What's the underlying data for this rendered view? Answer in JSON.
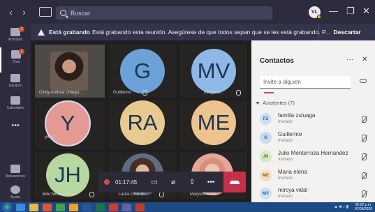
{
  "titlebar": {
    "search_placeholder": "Buscar",
    "user_initials": "VL"
  },
  "rail": {
    "items": [
      {
        "label": "Actividad",
        "badge": "1"
      },
      {
        "label": "Chat",
        "badge": "2"
      },
      {
        "label": "Equipos",
        "badge": ""
      },
      {
        "label": "Calendario",
        "badge": ""
      },
      {
        "label": "Aplicaciones",
        "badge": ""
      },
      {
        "label": "Ayuda",
        "badge": ""
      }
    ],
    "more": "•••"
  },
  "banner": {
    "bold": "Está grabando",
    "text": "Está grabando esta reunión. Asegúrese de que todos sepan que se les está grabando. P...",
    "dismiss": "Descartar"
  },
  "tiles": [
    {
      "name": "Cindy Andrea Umegu..."
    },
    {
      "initials": "G",
      "name": "Guillermo",
      "color": "#6ba1d6"
    },
    {
      "initials": "MV",
      "name": "mircya v...",
      "color": "#8fb8e6"
    },
    {
      "initials": "Y",
      "name": "yesid",
      "color": "#e39a94"
    },
    {
      "initials": "RA",
      "name": "",
      "color": "#e8c98f"
    },
    {
      "initials": "ME",
      "name": "",
      "color": "#efc38e"
    },
    {
      "initials": "JH",
      "name": "Julio Monterroza...",
      "color": "#b7d7a0"
    },
    {
      "name": "Laura Ortiz Pl..."
    },
    {
      "name": "Marysol Arcila..."
    }
  ],
  "controls": {
    "timer": "01:17:45"
  },
  "panel": {
    "title": "Contactos",
    "invite_placeholder": "Invite a alguien",
    "section": "Asistentes (7)",
    "attendees": [
      {
        "initials": "FZ",
        "name": "familia zuluaga",
        "role": "Invitado",
        "color": "#cde0f0",
        "text": "#2a5e8c"
      },
      {
        "initials": "G",
        "name": "Guillermo",
        "role": "Invitado",
        "color": "#c6dbf3",
        "text": "#2a5e8c"
      },
      {
        "initials": "JH",
        "name": "Julio Monterroza Hernández",
        "role": "Invitado",
        "color": "#d6e9c7",
        "text": "#3f6a2a"
      },
      {
        "initials": "ME",
        "name": "Maria elena",
        "role": "Invitado",
        "color": "#f6dcc0",
        "text": "#8a5a20"
      },
      {
        "initials": "MV",
        "name": "mircya vidal",
        "role": "Invitado",
        "color": "#cfe0f5",
        "text": "#2a5e8c"
      }
    ]
  },
  "taskbar": {
    "time": "05:02 p.m.",
    "date": "07/09/2020"
  },
  "colors": {
    "titlebar": "#2d2c3c",
    "accent": "#6264a7",
    "hangup": "#c4314b"
  }
}
